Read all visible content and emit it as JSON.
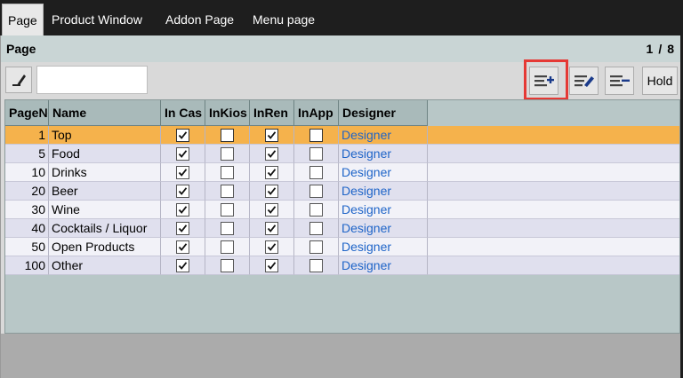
{
  "tabs": [
    {
      "label": "Page",
      "active": true
    },
    {
      "label": "Product Window",
      "active": false
    },
    {
      "label": "Addon Page",
      "active": false
    },
    {
      "label": "Menu page",
      "active": false
    }
  ],
  "header": {
    "title": "Page",
    "pager_current": "1",
    "pager_sep": "/",
    "pager_total": "8"
  },
  "toolbar": {
    "search_value": "",
    "edit_icon": "pencil-icon",
    "add_icon": "add-line-icon",
    "edit_line_icon": "edit-line-icon",
    "remove_icon": "remove-line-icon",
    "hold_label": "Hold"
  },
  "columns": [
    "Page№",
    "Name",
    "In Cas",
    "InKios",
    "InRen",
    "InApp",
    "Designer"
  ],
  "rows": [
    {
      "num": "1",
      "name": "Top",
      "in_cash": true,
      "in_kiosk": false,
      "in_ren": true,
      "in_app": false,
      "designer": "Designer",
      "selected": true
    },
    {
      "num": "5",
      "name": "Food",
      "in_cash": true,
      "in_kiosk": false,
      "in_ren": true,
      "in_app": false,
      "designer": "Designer",
      "selected": false
    },
    {
      "num": "10",
      "name": "Drinks",
      "in_cash": true,
      "in_kiosk": false,
      "in_ren": true,
      "in_app": false,
      "designer": "Designer",
      "selected": false
    },
    {
      "num": "20",
      "name": "Beer",
      "in_cash": true,
      "in_kiosk": false,
      "in_ren": true,
      "in_app": false,
      "designer": "Designer",
      "selected": false
    },
    {
      "num": "30",
      "name": "Wine",
      "in_cash": true,
      "in_kiosk": false,
      "in_ren": true,
      "in_app": false,
      "designer": "Designer",
      "selected": false
    },
    {
      "num": "40",
      "name": "Cocktails / Liquor",
      "in_cash": true,
      "in_kiosk": false,
      "in_ren": true,
      "in_app": false,
      "designer": "Designer",
      "selected": false
    },
    {
      "num": "50",
      "name": "Open Products",
      "in_cash": true,
      "in_kiosk": false,
      "in_ren": true,
      "in_app": false,
      "designer": "Designer",
      "selected": false
    },
    {
      "num": "100",
      "name": "Other",
      "in_cash": true,
      "in_kiosk": false,
      "in_ren": true,
      "in_app": false,
      "designer": "Designer",
      "selected": false
    }
  ],
  "colors": {
    "selected_row": "#f5b24c",
    "link": "#1e64c8",
    "highlight": "#e53935"
  }
}
